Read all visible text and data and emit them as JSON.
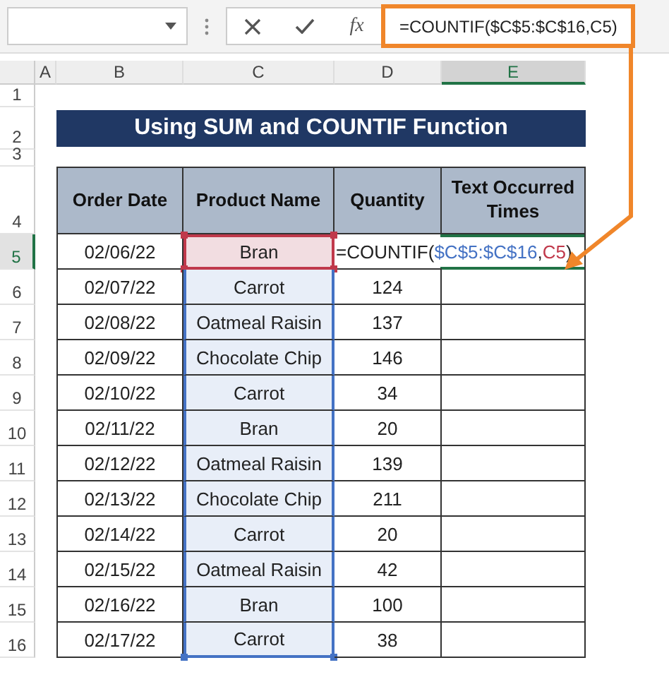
{
  "formula_bar": {
    "function_label": "fx",
    "value": "=COUNTIF($C$5:$C$16,C5)",
    "highlighted": true
  },
  "column_headers": [
    {
      "label": "A",
      "selected": false
    },
    {
      "label": "B",
      "selected": false
    },
    {
      "label": "C",
      "selected": false
    },
    {
      "label": "D",
      "selected": false
    },
    {
      "label": "E",
      "selected": true
    }
  ],
  "row_headers": [
    {
      "label": "1",
      "selected": false
    },
    {
      "label": "2",
      "selected": false
    },
    {
      "label": "3",
      "selected": false
    },
    {
      "label": "4",
      "selected": false
    },
    {
      "label": "5",
      "selected": true
    },
    {
      "label": "6",
      "selected": false
    },
    {
      "label": "7",
      "selected": false
    },
    {
      "label": "8",
      "selected": false
    },
    {
      "label": "9",
      "selected": false
    },
    {
      "label": "10",
      "selected": false
    },
    {
      "label": "11",
      "selected": false
    },
    {
      "label": "12",
      "selected": false
    },
    {
      "label": "13",
      "selected": false
    },
    {
      "label": "14",
      "selected": false
    },
    {
      "label": "15",
      "selected": false
    },
    {
      "label": "16",
      "selected": false
    }
  ],
  "title": "Using SUM and COUNTIF Function",
  "table": {
    "columns": [
      "Order Date",
      "Product Name",
      "Quantity",
      "Text Occurred Times"
    ],
    "rows": [
      {
        "order_date": "02/06/22",
        "product": "Bran",
        "criteria_reference": true
      },
      {
        "order_date": "02/07/22",
        "product": "Carrot",
        "criteria_reference": false,
        "in_range": true,
        "quantity": "124"
      },
      {
        "order_date": "02/08/22",
        "product": "Oatmeal Raisin",
        "criteria_reference": false,
        "in_range": true,
        "quantity": "137"
      },
      {
        "order_date": "02/09/22",
        "product": "Chocolate Chip",
        "criteria_reference": false,
        "in_range": true,
        "quantity": "146"
      },
      {
        "order_date": "02/10/22",
        "product": "Carrot",
        "criteria_reference": false,
        "in_range": true,
        "quantity": "34"
      },
      {
        "order_date": "02/11/22",
        "product": "Bran",
        "criteria_reference": false,
        "in_range": true,
        "quantity": "20"
      },
      {
        "order_date": "02/12/22",
        "product": "Oatmeal Raisin",
        "criteria_reference": false,
        "in_range": true,
        "quantity": "139"
      },
      {
        "order_date": "02/13/22",
        "product": "Chocolate Chip",
        "criteria_reference": false,
        "in_range": true,
        "quantity": "211"
      },
      {
        "order_date": "02/14/22",
        "product": "Carrot",
        "criteria_reference": false,
        "in_range": true,
        "quantity": "20"
      },
      {
        "order_date": "02/15/22",
        "product": "Oatmeal Raisin",
        "criteria_reference": false,
        "in_range": true,
        "quantity": "42"
      },
      {
        "order_date": "02/16/22",
        "product": "Bran",
        "criteria_reference": false,
        "in_range": true,
        "quantity": "100"
      },
      {
        "order_date": "02/17/22",
        "product": "Carrot",
        "criteria_reference": false,
        "in_range": true,
        "quantity": "38"
      }
    ]
  },
  "cell_editor": {
    "function": "=COUNTIF(",
    "arguments": [
      {
        "text": "$C$5:$C$16",
        "color": "#4472c4"
      },
      {
        "text": "C5",
        "color": "#c0394b"
      }
    ],
    "separator": ",",
    "closing": ")"
  }
}
